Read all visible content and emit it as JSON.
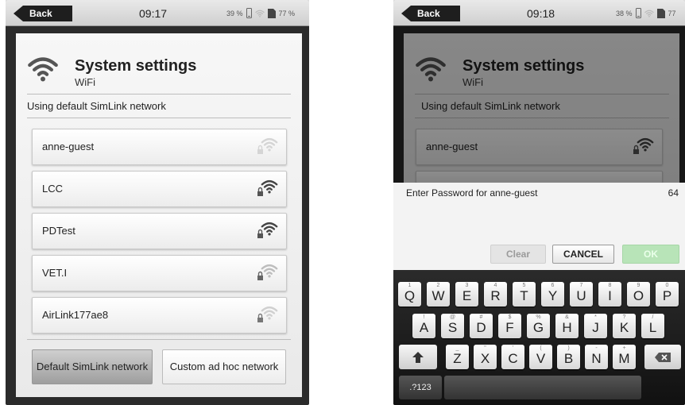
{
  "left": {
    "status": {
      "back": "Back",
      "time": "09:17",
      "signal": "39 %",
      "battery": "77 %"
    },
    "title": "System settings",
    "subtitle": "WiFi",
    "info": "Using default SimLink network",
    "networks": [
      "anne-guest",
      "LCC",
      "PDTest",
      "VET.I",
      "AirLink177ae8"
    ],
    "buttons": {
      "default": "Default SimLink network",
      "custom": "Custom ad hoc network"
    }
  },
  "right": {
    "status": {
      "back": "Back",
      "time": "09:18",
      "signal": "38 %",
      "battery": "77"
    },
    "title": "System settings",
    "subtitle": "WiFi",
    "info": "Using default SimLink network",
    "network": "anne-guest",
    "dialog": {
      "prompt": "Enter Password for anne-guest",
      "count": "64",
      "clear": "Clear",
      "cancel": "CANCEL",
      "ok": "OK"
    },
    "keyboard": {
      "row1": [
        [
          "Q",
          "1"
        ],
        [
          "W",
          "2"
        ],
        [
          "E",
          "3"
        ],
        [
          "R",
          "4"
        ],
        [
          "T",
          "5"
        ],
        [
          "Y",
          "6"
        ],
        [
          "U",
          "7"
        ],
        [
          "I",
          "8"
        ],
        [
          "O",
          "9"
        ],
        [
          "P",
          "0"
        ]
      ],
      "row2": [
        [
          "A",
          "!"
        ],
        [
          "S",
          "@"
        ],
        [
          "D",
          "#"
        ],
        [
          "F",
          "$"
        ],
        [
          "G",
          "%"
        ],
        [
          "H",
          "&"
        ],
        [
          "J",
          "*"
        ],
        [
          "K",
          "?"
        ],
        [
          "L",
          "/"
        ]
      ],
      "row3": [
        [
          "Z",
          "_"
        ],
        [
          "X",
          "\""
        ],
        [
          "C",
          "'"
        ],
        [
          "V",
          "("
        ],
        [
          "B",
          ")"
        ],
        [
          "N",
          "-"
        ],
        [
          "M",
          "+"
        ]
      ],
      "sym": ".?123"
    }
  },
  "icons": {
    "back": "back-arrow-icon",
    "wifi": "wifi-icon",
    "lock": "lock-icon",
    "shift": "shift-arrow-icon",
    "backspace": "backspace-icon"
  }
}
